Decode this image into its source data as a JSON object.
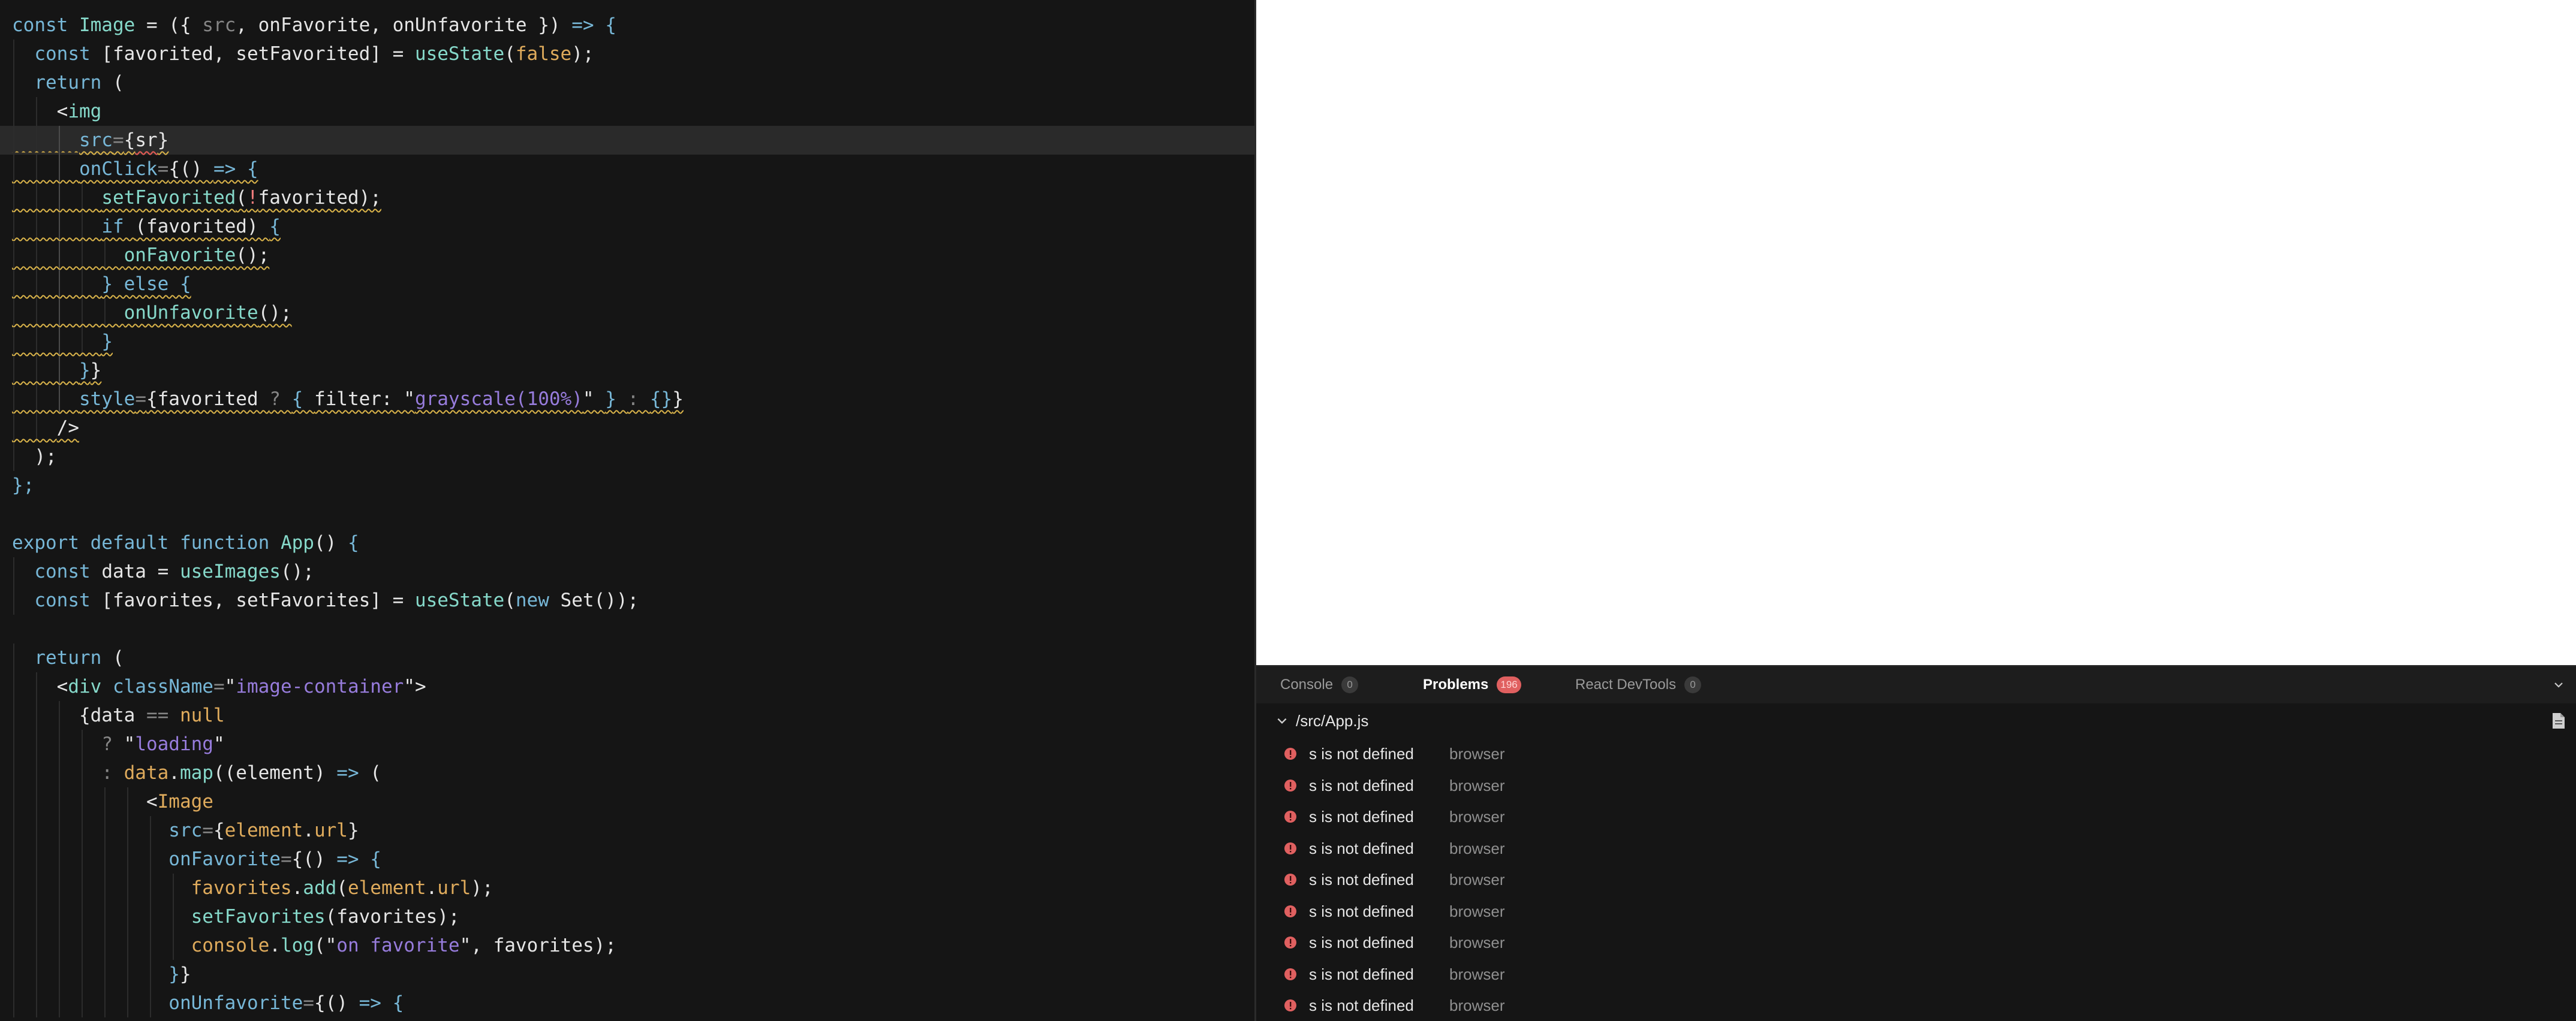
{
  "editor": {
    "active_line_index": 4,
    "lines": [
      {
        "indent": 0,
        "tokens": [
          [
            "kw",
            "const "
          ],
          [
            "name",
            "Image"
          ],
          [
            "txt",
            " = ({ "
          ],
          [
            "dim",
            "src"
          ],
          [
            "txt",
            ", onFavorite, onUnfavorite }) "
          ],
          [
            "kw",
            "=> {"
          ]
        ]
      },
      {
        "indent": 1,
        "tokens": [
          [
            "kw",
            "const "
          ],
          [
            "txt",
            "[favorited, setFavorited] = "
          ],
          [
            "name",
            "useState"
          ],
          [
            "txt",
            "("
          ],
          [
            "num",
            "false"
          ],
          [
            "txt",
            ");"
          ]
        ]
      },
      {
        "indent": 1,
        "tokens": [
          [
            "kw",
            "return "
          ],
          [
            "txt",
            "("
          ]
        ]
      },
      {
        "indent": 2,
        "tokens": [
          [
            "txt",
            "<"
          ],
          [
            "tag",
            "img"
          ]
        ]
      },
      {
        "indent": 3,
        "squig": true,
        "tokens": [
          [
            "attr",
            "src"
          ],
          [
            "dim",
            "="
          ],
          [
            "txt",
            "{"
          ],
          [
            "txt",
            "sr"
          ],
          [
            "txt",
            "}"
          ]
        ]
      },
      {
        "indent": 3,
        "squig": true,
        "tokens": [
          [
            "attr",
            "onClick"
          ],
          [
            "dim",
            "="
          ],
          [
            "txt",
            "{() "
          ],
          [
            "kw",
            "=> {"
          ]
        ]
      },
      {
        "indent": 4,
        "squig": true,
        "tokens": [
          [
            "name",
            "setFavorited"
          ],
          [
            "txt",
            "("
          ],
          [
            "neg",
            "!"
          ],
          [
            "txt",
            "favorited);"
          ]
        ]
      },
      {
        "indent": 4,
        "squig": true,
        "tokens": [
          [
            "kw",
            "if "
          ],
          [
            "txt",
            "(favorited) "
          ],
          [
            "kw",
            "{"
          ]
        ]
      },
      {
        "indent": 5,
        "squig": true,
        "tokens": [
          [
            "name",
            "onFavorite"
          ],
          [
            "txt",
            "();"
          ]
        ]
      },
      {
        "indent": 4,
        "squig": true,
        "tokens": [
          [
            "kw",
            "} else {"
          ]
        ]
      },
      {
        "indent": 5,
        "squig": true,
        "tokens": [
          [
            "name",
            "onUnfavorite"
          ],
          [
            "txt",
            "();"
          ]
        ]
      },
      {
        "indent": 4,
        "squig": true,
        "tokens": [
          [
            "kw",
            "}"
          ]
        ]
      },
      {
        "indent": 3,
        "squig": true,
        "tokens": [
          [
            "kw",
            "}"
          ],
          [
            "txt",
            "}"
          ]
        ]
      },
      {
        "indent": 3,
        "squig": true,
        "tokens": [
          [
            "attr",
            "style"
          ],
          [
            "dim",
            "="
          ],
          [
            "txt",
            "{favorited "
          ],
          [
            "dim",
            "? "
          ],
          [
            "kw",
            "{ "
          ],
          [
            "txt",
            "filter: \""
          ],
          [
            "str",
            "grayscale(100%)"
          ],
          [
            "txt",
            "\" "
          ],
          [
            "kw",
            "} "
          ],
          [
            "dim",
            ": "
          ],
          [
            "kw",
            "{}"
          ],
          [
            "txt",
            "}"
          ]
        ]
      },
      {
        "indent": 2,
        "squig": true,
        "tokens": [
          [
            "txt",
            "/>"
          ]
        ]
      },
      {
        "indent": 1,
        "tokens": [
          [
            "txt",
            ");"
          ]
        ]
      },
      {
        "indent": 0,
        "tokens": [
          [
            "kw",
            "};"
          ]
        ]
      },
      {
        "indent": 0,
        "tokens": [
          [
            "txt",
            ""
          ]
        ]
      },
      {
        "indent": 0,
        "tokens": [
          [
            "kw",
            "export default function "
          ],
          [
            "name",
            "App"
          ],
          [
            "txt",
            "() "
          ],
          [
            "kw",
            "{"
          ]
        ]
      },
      {
        "indent": 1,
        "tokens": [
          [
            "kw",
            "const "
          ],
          [
            "txt",
            "data = "
          ],
          [
            "name",
            "useImages"
          ],
          [
            "txt",
            "();"
          ]
        ]
      },
      {
        "indent": 1,
        "tokens": [
          [
            "kw",
            "const "
          ],
          [
            "txt",
            "[favorites, setFavorites] = "
          ],
          [
            "name",
            "useState"
          ],
          [
            "txt",
            "("
          ],
          [
            "kw",
            "new "
          ],
          [
            "txt",
            "Set());"
          ]
        ]
      },
      {
        "indent": 0,
        "tokens": [
          [
            "txt",
            ""
          ]
        ]
      },
      {
        "indent": 1,
        "tokens": [
          [
            "kw",
            "return "
          ],
          [
            "txt",
            "("
          ]
        ]
      },
      {
        "indent": 2,
        "tokens": [
          [
            "txt",
            "<"
          ],
          [
            "tag",
            "div "
          ],
          [
            "attr",
            "className"
          ],
          [
            "dim",
            "="
          ],
          [
            "txt",
            "\""
          ],
          [
            "str",
            "image-container"
          ],
          [
            "txt",
            "\">"
          ]
        ]
      },
      {
        "indent": 3,
        "tokens": [
          [
            "txt",
            "{data "
          ],
          [
            "dim",
            "== "
          ],
          [
            "num",
            "null"
          ]
        ]
      },
      {
        "indent": 4,
        "tokens": [
          [
            "dim",
            "? "
          ],
          [
            "txt",
            "\""
          ],
          [
            "str",
            "loading"
          ],
          [
            "txt",
            "\""
          ]
        ]
      },
      {
        "indent": 4,
        "tokens": [
          [
            "dim",
            ": "
          ],
          [
            "num",
            "data"
          ],
          [
            "txt",
            "."
          ],
          [
            "name",
            "map"
          ],
          [
            "txt",
            "((element) "
          ],
          [
            "kw",
            "=> "
          ],
          [
            "txt",
            "("
          ]
        ]
      },
      {
        "indent": 6,
        "tokens": [
          [
            "txt",
            "<"
          ],
          [
            "num",
            "Image"
          ]
        ]
      },
      {
        "indent": 7,
        "tokens": [
          [
            "attr",
            "src"
          ],
          [
            "dim",
            "="
          ],
          [
            "txt",
            "{"
          ],
          [
            "num",
            "element"
          ],
          [
            "txt",
            "."
          ],
          [
            "num",
            "url"
          ],
          [
            "txt",
            "}"
          ]
        ]
      },
      {
        "indent": 7,
        "tokens": [
          [
            "attr",
            "onFavorite"
          ],
          [
            "dim",
            "="
          ],
          [
            "txt",
            "{() "
          ],
          [
            "kw",
            "=> {"
          ]
        ]
      },
      {
        "indent": 8,
        "tokens": [
          [
            "num",
            "favorites"
          ],
          [
            "txt",
            "."
          ],
          [
            "name",
            "add"
          ],
          [
            "txt",
            "("
          ],
          [
            "num",
            "element"
          ],
          [
            "txt",
            "."
          ],
          [
            "num",
            "url"
          ],
          [
            "txt",
            ");"
          ]
        ]
      },
      {
        "indent": 8,
        "tokens": [
          [
            "name",
            "setFavorites"
          ],
          [
            "txt",
            "(favorites);"
          ]
        ]
      },
      {
        "indent": 8,
        "tokens": [
          [
            "num",
            "console"
          ],
          [
            "txt",
            "."
          ],
          [
            "name",
            "log"
          ],
          [
            "txt",
            "(\""
          ],
          [
            "str",
            "on favorite"
          ],
          [
            "txt",
            "\", favorites);"
          ]
        ]
      },
      {
        "indent": 7,
        "tokens": [
          [
            "kw",
            "}"
          ],
          [
            "txt",
            "}"
          ]
        ]
      },
      {
        "indent": 7,
        "tokens": [
          [
            "attr",
            "onUnfavorite"
          ],
          [
            "dim",
            "="
          ],
          [
            "txt",
            "{() "
          ],
          [
            "kw",
            "=> {"
          ]
        ]
      }
    ]
  },
  "preview": {},
  "panel": {
    "tabs": [
      {
        "label": "Console",
        "badge": "0",
        "active": false
      },
      {
        "label": "Problems",
        "badge": "196",
        "active": true,
        "badge_style": "error"
      },
      {
        "label": "React DevTools",
        "badge": "0",
        "active": false
      }
    ],
    "file": "/src/App.js",
    "problems": [
      {
        "message": "s is not defined",
        "source": "browser"
      },
      {
        "message": "s is not defined",
        "source": "browser"
      },
      {
        "message": "s is not defined",
        "source": "browser"
      },
      {
        "message": "s is not defined",
        "source": "browser"
      },
      {
        "message": "s is not defined",
        "source": "browser"
      },
      {
        "message": "s is not defined",
        "source": "browser"
      },
      {
        "message": "s is not defined",
        "source": "browser"
      },
      {
        "message": "s is not defined",
        "source": "browser"
      },
      {
        "message": "s is not defined",
        "source": "browser"
      }
    ]
  },
  "colors": {
    "editor_bg": "#151515",
    "keyword": "#77b7d7",
    "identifier": "#86d9ca",
    "string": "#977cdc",
    "constant": "#dfab5c",
    "error_badge": "#e06060",
    "error_icon": "#e06060"
  },
  "icons": {
    "collapse": "chevron-down-icon",
    "file_toggle": "chevron-down-icon",
    "file_action": "file-icon",
    "problem": "error-circle-icon"
  }
}
